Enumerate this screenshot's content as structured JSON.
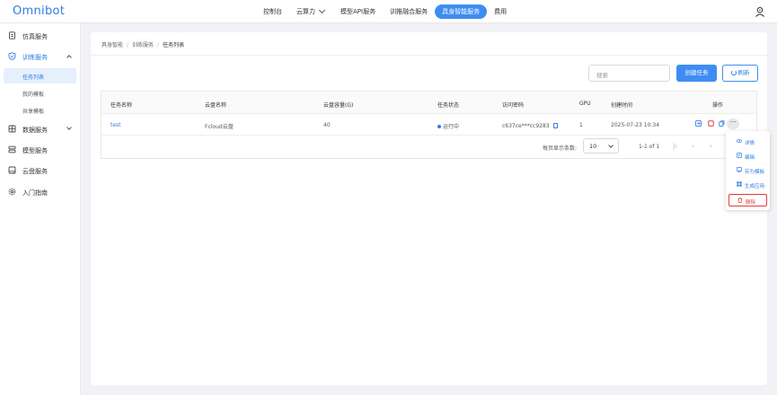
{
  "header": {
    "logo": "Omnibot",
    "nav": [
      {
        "label": "控制台"
      },
      {
        "label": "云算力"
      },
      {
        "label": "模型API服务"
      },
      {
        "label": "训推融合服务"
      },
      {
        "label": "具身智能服务"
      },
      {
        "label": "费用"
      }
    ],
    "active_nav": "具身智能服务"
  },
  "sidebar": {
    "items": [
      {
        "label": "仿真服务",
        "icon": "document-icon"
      },
      {
        "label": "训练服务",
        "icon": "shield-icon",
        "expanded": true
      },
      {
        "label": "数据服务",
        "icon": "data-icon",
        "expanded": false
      },
      {
        "label": "模型服务",
        "icon": "layers-icon"
      },
      {
        "label": "云盘服务",
        "icon": "disk-icon"
      },
      {
        "label": "入门指南",
        "icon": "gear-icon"
      }
    ],
    "sub_items": [
      {
        "label": "任务列表",
        "active": true
      },
      {
        "label": "我的模板"
      },
      {
        "label": "共享模板"
      }
    ]
  },
  "breadcrumb": [
    "具身智能",
    "训练服务",
    "任务列表"
  ],
  "toolbar": {
    "search_placeholder": "搜索",
    "create_label": "创建任务",
    "refresh_label": "刷新"
  },
  "table": {
    "columns": [
      "任务名称",
      "云盘名称",
      "云盘容量(G)",
      "任务状态",
      "访问密码",
      "GPU",
      "创建时间",
      "操作"
    ],
    "rows": [
      {
        "name": "test",
        "disk_name": "Fcloud云盘",
        "disk_capacity": "40",
        "status": "运行中",
        "password": "c637ce***cc9283",
        "gpu": "1",
        "created": "2025-07-23 10:34"
      }
    ]
  },
  "pagination": {
    "page_size_label": "每页显示条数:",
    "page_size": "10",
    "range": "1-1 of 1"
  },
  "more_menu": {
    "items": [
      {
        "label": "详情",
        "icon": "eye-icon"
      },
      {
        "label": "编辑",
        "icon": "edit-icon"
      },
      {
        "label": "存为模板",
        "icon": "template-icon"
      },
      {
        "label": "生成应用",
        "icon": "grid-icon"
      },
      {
        "label": "删除",
        "icon": "trash-icon",
        "danger": true
      }
    ]
  },
  "colors": {
    "primary": "#3e8df3",
    "danger": "#e23c3c"
  }
}
